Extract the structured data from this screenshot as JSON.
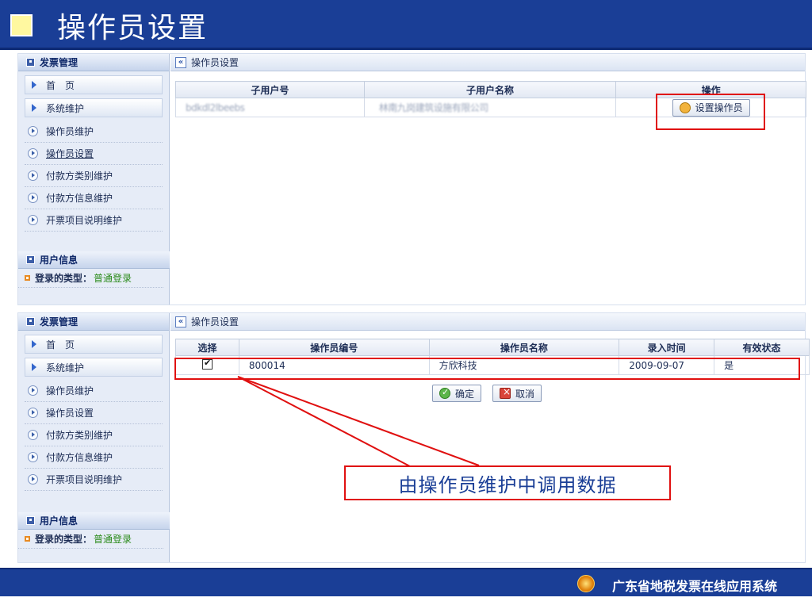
{
  "slide_title": "操作员设置",
  "sidebar": {
    "section_title": "发票管理",
    "top_items": [
      "首　页",
      "系统维护"
    ],
    "items": [
      "操作员维护",
      "操作员设置",
      "付款方类别维护",
      "付款方信息维护",
      "开票项目说明维护"
    ],
    "user_section_title": "用户信息",
    "login_type_label": "登录的类型：",
    "login_type_value": "普通登录"
  },
  "panel1": {
    "breadcrumb": "操作员设置",
    "columns": [
      "子用户号",
      "子用户名称",
      "操作"
    ],
    "row": {
      "sub_user_no": "bdkdl2lbeebs",
      "sub_user_name": "林南九岗建筑设施有限公司",
      "action_button": "设置操作员"
    }
  },
  "panel2": {
    "breadcrumb": "操作员设置",
    "columns": [
      "选择",
      "操作员编号",
      "操作员名称",
      "录入时间",
      "有效状态"
    ],
    "row": {
      "checked": true,
      "operator_no": "800014",
      "operator_name": "方欣科技",
      "entry_time": "2009-09-07",
      "status": "是"
    },
    "ok_button": "确定",
    "cancel_button": "取消"
  },
  "callout_text": "由操作员维护中调用数据",
  "footer_text": "广东省地税发票在线应用系统",
  "colors": {
    "brand_blue": "#1a3e96",
    "highlight_red": "#e01010",
    "sidebar_bg": "#e6ecf7"
  }
}
